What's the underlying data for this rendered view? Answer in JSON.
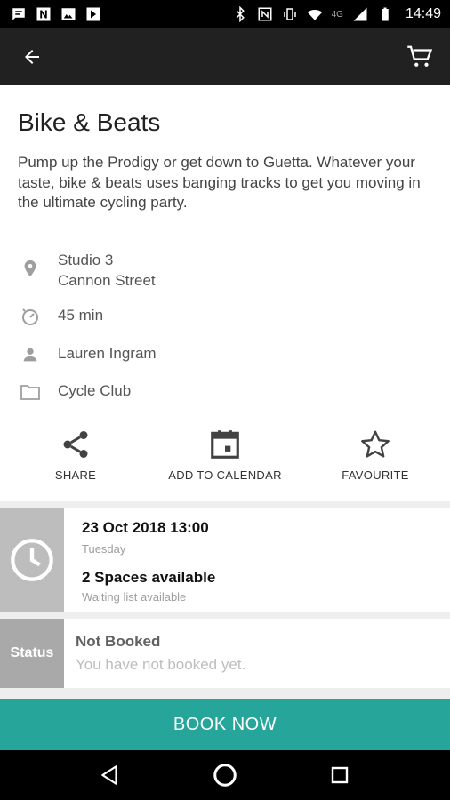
{
  "status_bar": {
    "time": "14:49",
    "network": "4G",
    "icons": [
      "message-icon",
      "n-notification-icon",
      "image-icon",
      "download-icon",
      "bluetooth-icon",
      "nfc-icon",
      "vibrate-icon",
      "wifi-icon",
      "signal-icon",
      "battery-icon"
    ]
  },
  "app_bar": {
    "back_icon": "arrow-back-icon",
    "cart_icon": "cart-icon"
  },
  "class": {
    "title": "Bike & Beats",
    "description": "Pump up the Prodigy or get down to Guetta. Whatever your taste, bike & beats uses banging tracks to get you moving in the ultimate cycling party."
  },
  "details": {
    "location_line1": "Studio 3",
    "location_line2": "Cannon Street",
    "duration": "45 min",
    "instructor": "Lauren Ingram",
    "category": "Cycle Club"
  },
  "actions": {
    "share": "SHARE",
    "calendar": "ADD TO CALENDAR",
    "favourite": "FAVOURITE"
  },
  "session": {
    "datetime": "23 Oct 2018 13:00",
    "day": "Tuesday",
    "spaces": "2 Spaces available",
    "waiting": "Waiting list available"
  },
  "booking_status": {
    "side_label": "Status",
    "title": "Not Booked",
    "subtitle": "You have not booked yet."
  },
  "book_button": "BOOK NOW",
  "colors": {
    "app_bar": "#212121",
    "accent": "#26a69a",
    "card_side": "#bdbdbd"
  }
}
